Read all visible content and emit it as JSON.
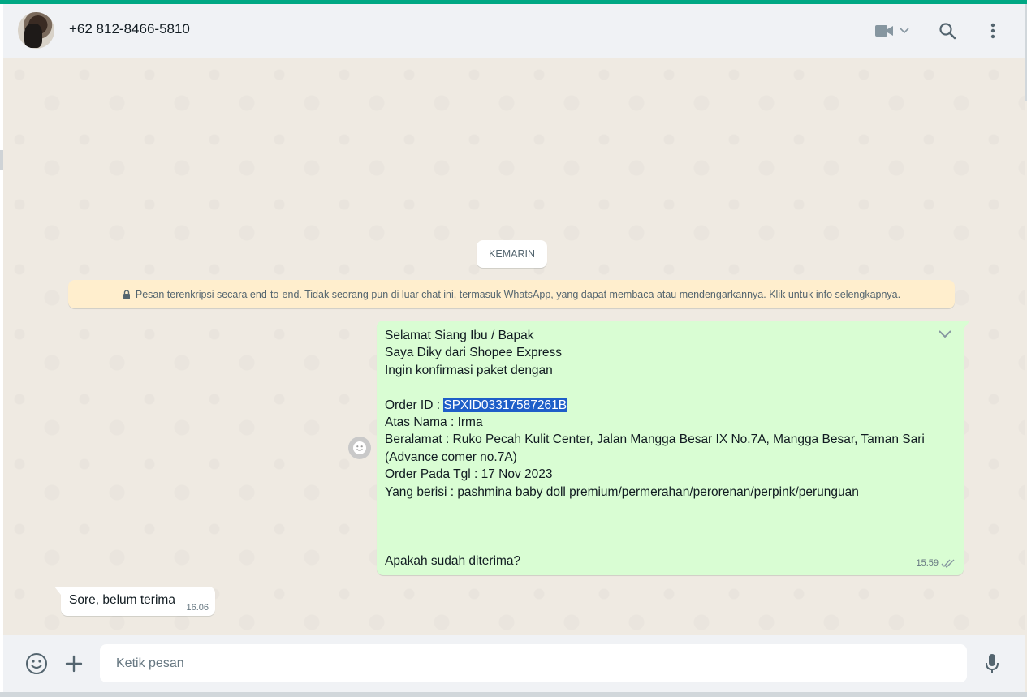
{
  "header": {
    "contact_name": "+62 812-8466-5810"
  },
  "chat": {
    "date_label": "KEMARIN",
    "encryption_notice": "Pesan terenkripsi secara end-to-end. Tidak seorang pun di luar chat ini, termasuk WhatsApp, yang dapat membaca atau mendengarkannya. Klik untuk info selengkapnya.",
    "outgoing": {
      "lines": [
        "Selamat Siang Ibu / Bapak",
        "Saya Diky dari Shopee Express",
        "Ingin konfirmasi paket dengan",
        "",
        "Order ID : ",
        "Atas Nama : Irma",
        "Beralamat : Ruko Pecah Kulit Center, Jalan Mangga Besar IX No.7A, Mangga Besar, Taman Sari",
        "(Advance comer no.7A)",
        "Order Pada Tgl : 17 Nov 2023",
        "Yang berisi : pashmina baby doll premium/permerahan/perorenan/perpink/perunguan",
        "",
        "",
        "",
        "Apakah sudah diterima?"
      ],
      "selected_order_id": "SPXID03317587261B",
      "time": "15.59",
      "status": "read"
    },
    "incoming": {
      "text": "Sore, belum terima",
      "time": "16.06"
    }
  },
  "footer": {
    "input_placeholder": "Ketik pesan"
  },
  "colors": {
    "accent": "#00a884",
    "outgoing_bubble": "#d9fdd3",
    "incoming_bubble": "#ffffff",
    "notice_bg": "#ffeecd",
    "selection": "#1e5ec8"
  }
}
